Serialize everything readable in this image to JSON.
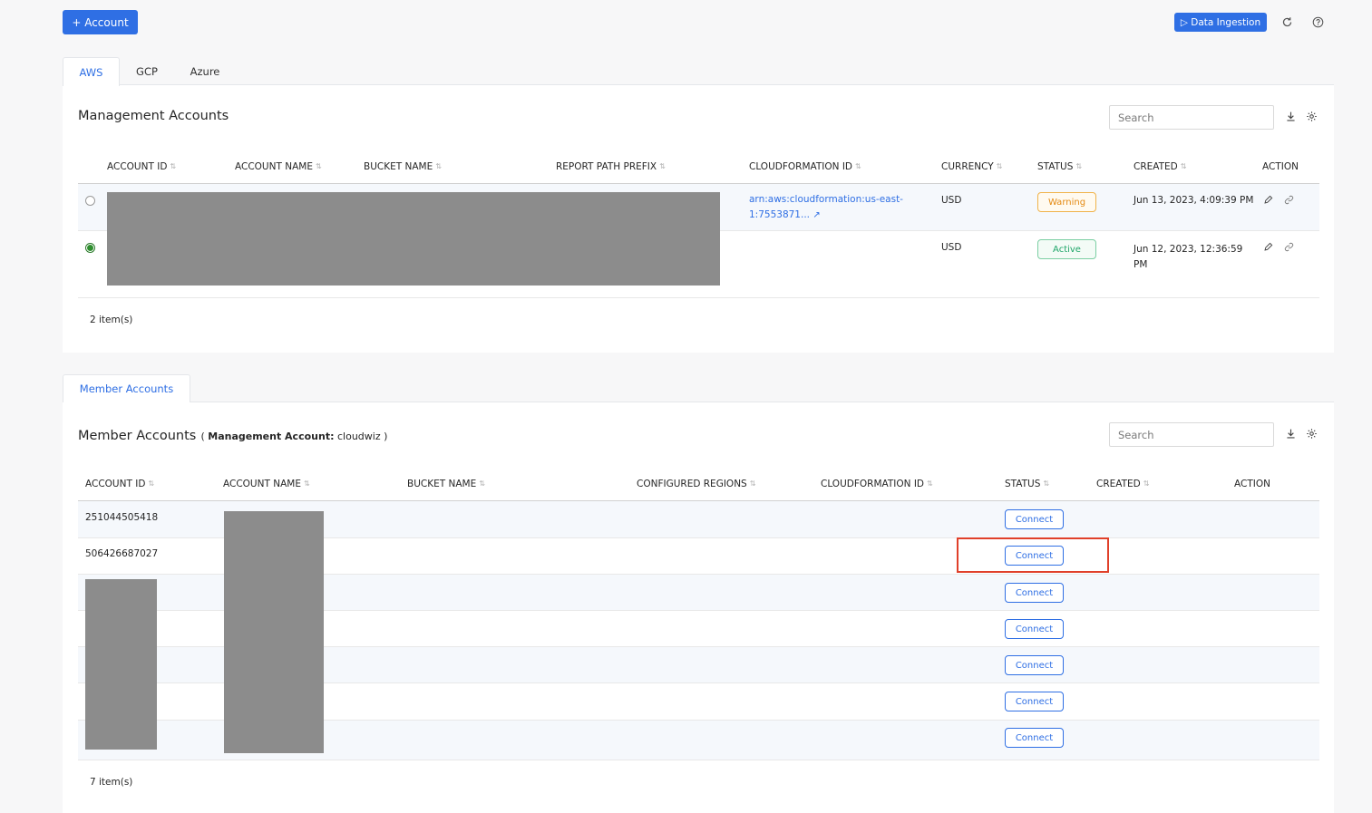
{
  "toolbar": {
    "add_account_label": "+ Account",
    "data_ingestion_label": "▷ Data Ingestion",
    "refresh_icon": "refresh-icon",
    "help_icon": "help-icon"
  },
  "cloud_tabs": [
    {
      "label": "AWS",
      "active": true
    },
    {
      "label": "GCP",
      "active": false
    },
    {
      "label": "Azure",
      "active": false
    }
  ],
  "management": {
    "title": "Management Accounts",
    "search_placeholder": "Search",
    "columns": [
      "ACCOUNT ID",
      "ACCOUNT NAME",
      "BUCKET NAME",
      "REPORT PATH PREFIX",
      "CLOUDFORMATION ID",
      "CURRENCY",
      "STATUS",
      "CREATED",
      "ACTION"
    ],
    "rows": [
      {
        "selected": false,
        "cloudformation_id_line1": "arn:aws:cloudformation:us-east-",
        "cloudformation_id_line2": "1:7553871...",
        "currency": "USD",
        "status": "Warning",
        "created_line1": "Jun 13, 2023, 4:09:39 PM",
        "created_line2": ""
      },
      {
        "selected": true,
        "cloudformation_id_line1": "",
        "cloudformation_id_line2": "",
        "currency": "USD",
        "status": "Active",
        "created_line1": "Jun 12, 2023, 12:36:59",
        "created_line2": "PM"
      }
    ],
    "item_count": "2 item(s)"
  },
  "member_tab_label": "Member Accounts",
  "member": {
    "title": "Member Accounts",
    "subtitle_prefix": "( ",
    "subtitle_key": "Management Account:",
    "subtitle_value": " cloudwiz )",
    "search_placeholder": "Search",
    "columns": [
      "ACCOUNT ID",
      "ACCOUNT NAME",
      "BUCKET NAME",
      "CONFIGURED REGIONS",
      "CLOUDFORMATION ID",
      "STATUS",
      "CREATED",
      "ACTION"
    ],
    "rows": [
      {
        "account_id": "251044505418",
        "status": "Connect"
      },
      {
        "account_id": "506426687027",
        "status": "Connect"
      },
      {
        "account_id": "",
        "status": "Connect"
      },
      {
        "account_id": "",
        "status": "Connect"
      },
      {
        "account_id": "",
        "status": "Connect"
      },
      {
        "account_id": "",
        "status": "Connect"
      },
      {
        "account_id": "",
        "status": "Connect"
      }
    ],
    "item_count": "7 item(s)"
  },
  "colors": {
    "accent": "#2f6fe4",
    "warning": "#e48a13",
    "active": "#20a66a",
    "highlight": "#e0402a"
  }
}
